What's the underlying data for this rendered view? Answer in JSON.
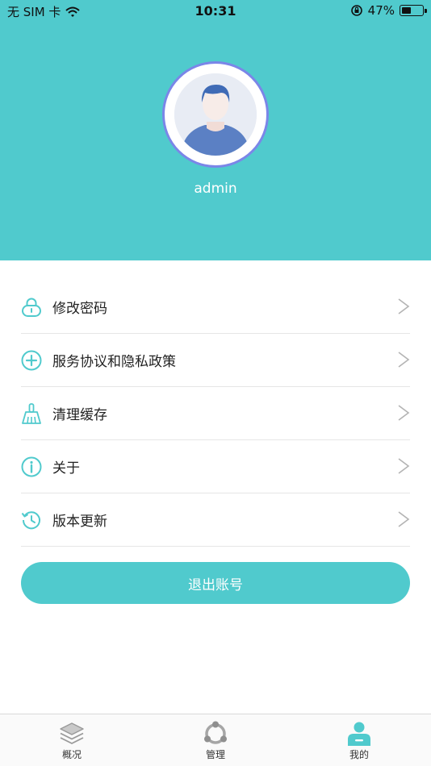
{
  "status_bar": {
    "carrier": "无 SIM 卡",
    "time": "10:31",
    "battery_percent": "47%",
    "battery_level": 0.47
  },
  "profile": {
    "username": "admin"
  },
  "menu": {
    "items": [
      {
        "label": "修改密码",
        "icon": "lock-icon"
      },
      {
        "label": "服务协议和隐私政策",
        "icon": "plus-circle-icon"
      },
      {
        "label": "清理缓存",
        "icon": "broom-icon"
      },
      {
        "label": "关于",
        "icon": "info-icon"
      },
      {
        "label": "版本更新",
        "icon": "history-icon"
      }
    ],
    "arrow": ">"
  },
  "logout_label": "退出账号",
  "tabbar": {
    "tabs": [
      {
        "label": "概况",
        "icon": "layers-icon",
        "active": false
      },
      {
        "label": "管理",
        "icon": "manage-icon",
        "active": false
      },
      {
        "label": "我的",
        "icon": "user-icon",
        "active": true
      }
    ]
  },
  "colors": {
    "accent": "#50cacd",
    "text": "#222222",
    "divider": "#e6e6e6"
  }
}
